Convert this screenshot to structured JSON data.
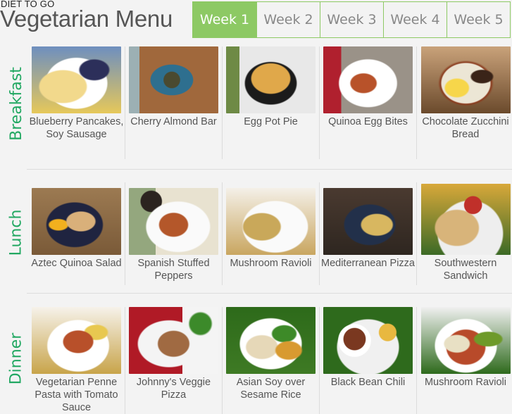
{
  "header": {
    "brand": "DIET TO GO",
    "title": "Vegetarian Menu"
  },
  "tabs": [
    {
      "label": "Week 1",
      "active": true
    },
    {
      "label": "Week 2",
      "active": false
    },
    {
      "label": "Week 3",
      "active": false
    },
    {
      "label": "Week 4",
      "active": false
    },
    {
      "label": "Week 5",
      "active": false
    }
  ],
  "colors": {
    "accent_green": "#8dc964",
    "section_label_green": "#22a862",
    "tab_inactive_text": "#888888",
    "caption_text": "#555555",
    "background": "#f3f3f3"
  },
  "sections": [
    {
      "label": "Breakfast",
      "items": [
        {
          "name": "Blueberry Pancakes, Soy Sausage",
          "image": "blueberry-pancakes-photo"
        },
        {
          "name": "Cherry Almond Bar",
          "image": "cherry-almond-bar-photo"
        },
        {
          "name": "Egg Pot Pie",
          "image": "egg-pot-pie-photo"
        },
        {
          "name": "Quinoa Egg Bites",
          "image": "quinoa-egg-bites-photo"
        },
        {
          "name": "Chocolate Zucchini Bread",
          "image": "chocolate-zucchini-bread-photo"
        }
      ]
    },
    {
      "label": "Lunch",
      "items": [
        {
          "name": "Aztec Quinoa Salad",
          "image": "aztec-quinoa-salad-photo"
        },
        {
          "name": "Spanish Stuffed Peppers",
          "image": "spanish-stuffed-peppers-photo"
        },
        {
          "name": "Mushroom Ravioli",
          "image": "mushroom-ravioli-photo"
        },
        {
          "name": "Mediterranean Pizza",
          "image": "mediterranean-pizza-photo"
        },
        {
          "name": "Southwestern Sandwich",
          "image": "southwestern-sandwich-photo"
        }
      ]
    },
    {
      "label": "Dinner",
      "items": [
        {
          "name": "Vegetarian Penne Pasta with Tomato Sauce",
          "image": "vegetarian-penne-pasta-photo"
        },
        {
          "name": "Johnny's Veggie Pizza",
          "image": "johnnys-veggie-pizza-photo"
        },
        {
          "name": "Asian Soy over Sesame Rice",
          "image": "asian-soy-sesame-rice-photo"
        },
        {
          "name": "Black Bean Chili",
          "image": "black-bean-chili-photo"
        },
        {
          "name": "Mushroom Ravioli",
          "image": "mushroom-ravioli-dinner-photo"
        }
      ]
    }
  ]
}
